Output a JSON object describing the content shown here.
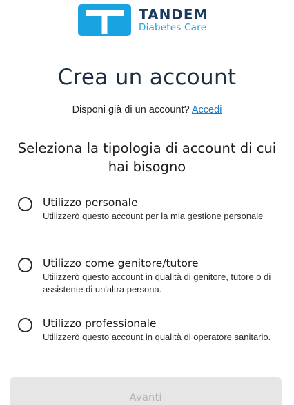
{
  "brand": {
    "name": "TANDEM",
    "subtitle": "Diabetes Care",
    "icon": "tandem-logo-t",
    "colors": {
      "primary": "#1aa3e1",
      "dark": "#1c3a5e"
    }
  },
  "header": {
    "title": "Crea un account",
    "signin_prompt": "Disponi già di un account?",
    "signin_link": "Accedi"
  },
  "question": "Seleziona la tipologia di account di cui hai bisogno",
  "options": [
    {
      "label": "Utilizzo personale",
      "description": "Utilizzerò questo account per la mia gestione personale",
      "selected": false
    },
    {
      "label": "Utilizzo come genitore/tutore",
      "description": "Utilizzerò questo account in qualità di genitore, tutore o di assistente di un'altra persona.",
      "selected": false
    },
    {
      "label": "Utilizzo professionale",
      "description": "Utilizzerò questo account in qualità di operatore sanitario.",
      "selected": false
    }
  ],
  "actions": {
    "next_label": "Avanti",
    "next_enabled": false
  }
}
